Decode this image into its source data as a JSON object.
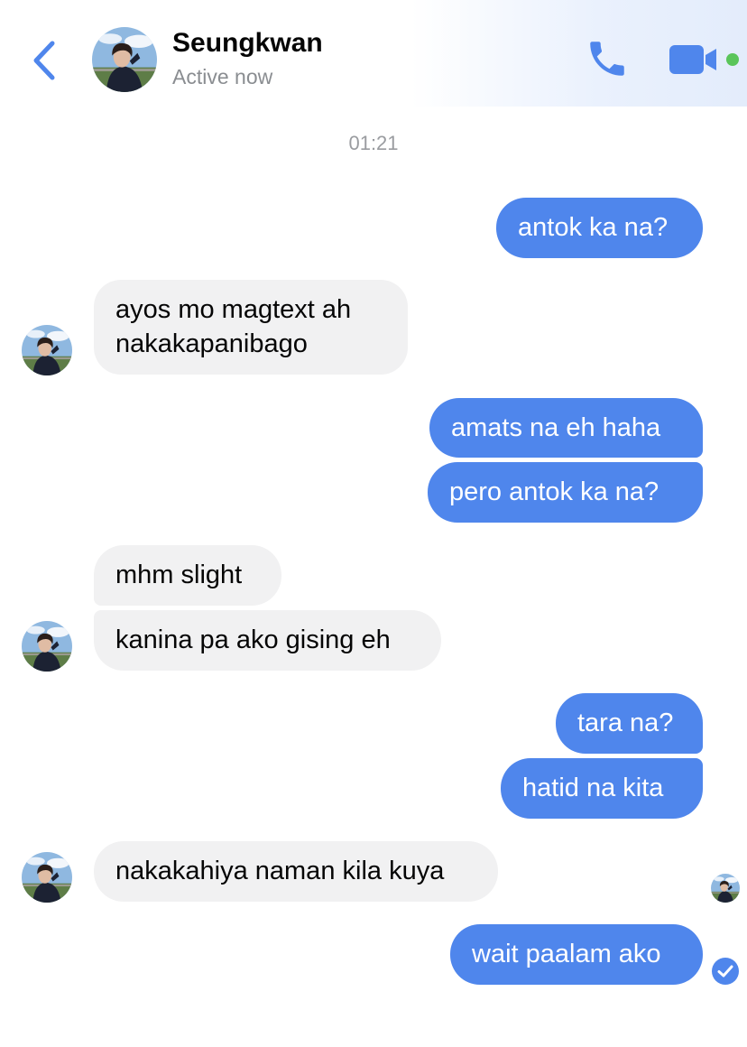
{
  "header": {
    "contact_name": "Seungkwan",
    "status": "Active now"
  },
  "colors": {
    "accent": "#4f86ec",
    "incoming_bubble": "#f1f1f2",
    "online": "#5ac55a"
  },
  "icons": {
    "back": "chevron-left-icon",
    "call": "phone-icon",
    "video": "video-camera-icon",
    "delivered": "check-circle-icon"
  },
  "conversation": {
    "timestamp": "01:21",
    "messages": [
      {
        "from": "me",
        "text": "antok ka na?"
      },
      {
        "from": "them",
        "lines": [
          "ayos mo magtext ah",
          "nakakapanibago"
        ]
      },
      {
        "from": "me",
        "text": "amats na eh haha"
      },
      {
        "from": "me",
        "text": "pero antok ka na?"
      },
      {
        "from": "them",
        "text": "mhm slight"
      },
      {
        "from": "them",
        "text": "kanina pa ako gising eh"
      },
      {
        "from": "me",
        "text": "tara na?"
      },
      {
        "from": "me",
        "text": "hatid na kita"
      },
      {
        "from": "them",
        "text": "nakakahiya naman kila kuya"
      },
      {
        "from": "me",
        "text": "wait paalam ako"
      }
    ]
  }
}
